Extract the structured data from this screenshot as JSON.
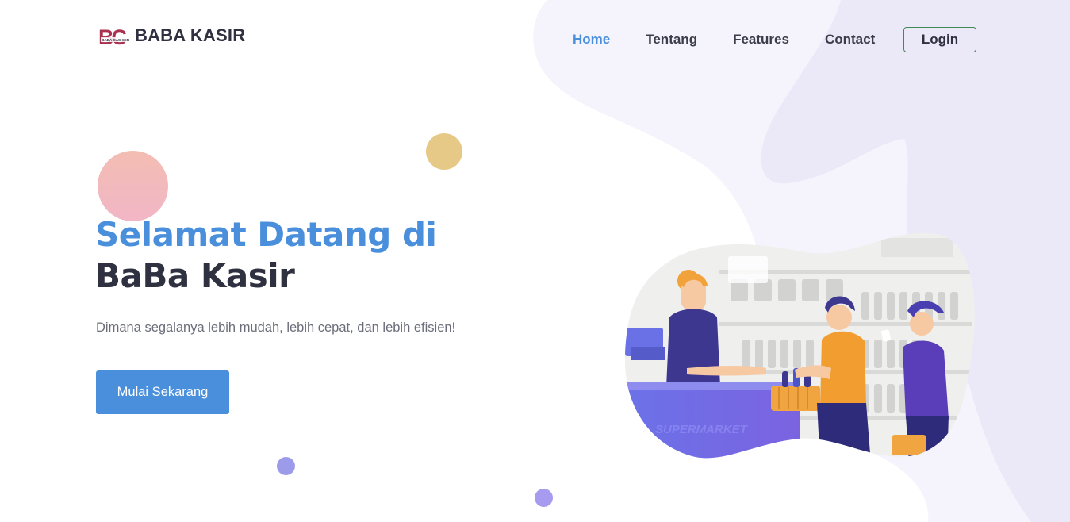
{
  "brand": {
    "logo_mark_text": "BC",
    "logo_sub_text": "BABA CASHIER",
    "name": "BABA KASIR"
  },
  "nav": {
    "items": [
      {
        "label": "Home",
        "active": true
      },
      {
        "label": "Tentang",
        "active": false
      },
      {
        "label": "Features",
        "active": false
      },
      {
        "label": "Contact",
        "active": false
      }
    ],
    "login_label": "Login"
  },
  "hero": {
    "title_line1": "Selamat Datang di",
    "title_line2": "BaBa Kasir",
    "subtitle": "Dimana segalanya lebih mudah, lebih cepat, dan lebih efisien!",
    "cta_label": "Mulai Sekarang"
  },
  "illustration": {
    "sign_text": "SUPERMARKET",
    "icon": "supermarket-cashier-illustration"
  },
  "colors": {
    "accent_blue": "#4a8fdc",
    "dark_text": "#2f3140",
    "login_border": "#3e8a55",
    "blob_light": "#f5f4fc",
    "blob_mid": "#e9e7f7"
  }
}
